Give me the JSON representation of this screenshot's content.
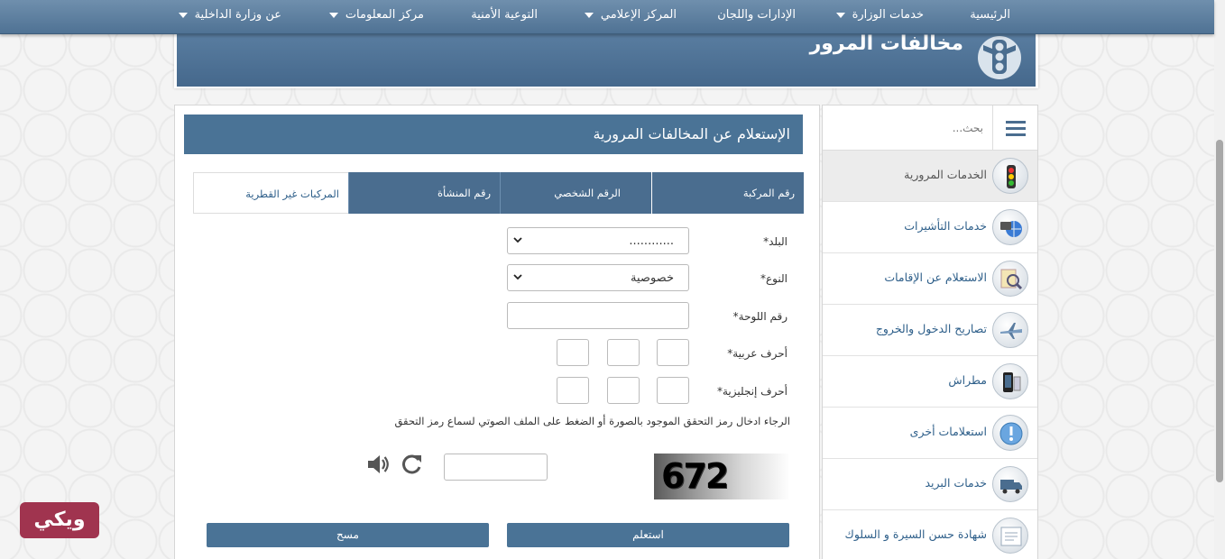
{
  "nav": {
    "items": [
      {
        "label": "الرئيسية",
        "dropdown": false
      },
      {
        "label": "خدمات الوزارة",
        "dropdown": true
      },
      {
        "label": "الإدارات واللجان",
        "dropdown": false
      },
      {
        "label": "المركز الإعلامي",
        "dropdown": true
      },
      {
        "label": "التوعية الأمنية",
        "dropdown": false
      },
      {
        "label": "مركز المعلومات",
        "dropdown": true
      },
      {
        "label": "عن وزارة الداخلية",
        "dropdown": true
      }
    ]
  },
  "banner": {
    "title": "مخالفات المرور",
    "icon": "traffic-light-icon"
  },
  "sidebar": {
    "search_placeholder": "بحث...",
    "items": [
      {
        "label": "الخدمات المرورية",
        "icon": "traffic-light-icon",
        "active": true
      },
      {
        "label": "خدمات التأشيرات",
        "icon": "visa-globe-icon",
        "active": false
      },
      {
        "label": "الاستعلام عن الإقامات",
        "icon": "residency-search-icon",
        "active": false
      },
      {
        "label": "تصاريح الدخول والخروج",
        "icon": "airplane-icon",
        "active": false
      },
      {
        "label": "مطراش",
        "icon": "metrash-phone-icon",
        "active": false
      },
      {
        "label": "استعلامات أخرى",
        "icon": "info-exclamation-icon",
        "active": false
      },
      {
        "label": "خدمات البريد",
        "icon": "mail-truck-icon",
        "active": false
      },
      {
        "label": "شهادة حسن السيرة و السلوك",
        "icon": "certificate-icon",
        "active": false
      }
    ]
  },
  "main": {
    "title": "الإستعلام عن المخالفات المرورية",
    "tabs": [
      {
        "label": "رقم المركبة"
      },
      {
        "label": "الرقم الشخصي"
      },
      {
        "label": "رقم المنشأة"
      },
      {
        "label": "المركبات غير القطرية"
      }
    ],
    "form": {
      "country_label": "البلد",
      "country_value": "............",
      "type_label": "النوع",
      "type_value": "خصوصية",
      "plate_label": "رقم اللوحة",
      "arabic_letters_label": "أحرف عربية",
      "english_letters_label": "أحرف إنجليزية",
      "required_mark": "*",
      "captcha_note": "الرجاء ادخال رمز التحقق الموجود بالصورة أو الضغط على الملف الصوتي لسماع رمز التحقق",
      "captcha_code": "672",
      "submit_label": "استعلم",
      "clear_label": "مسح"
    }
  },
  "watermark": {
    "text": "ويكي"
  },
  "colors": {
    "nav": "#5a7c9e",
    "panel_header": "#4a7396",
    "link": "#2e5f8a"
  }
}
